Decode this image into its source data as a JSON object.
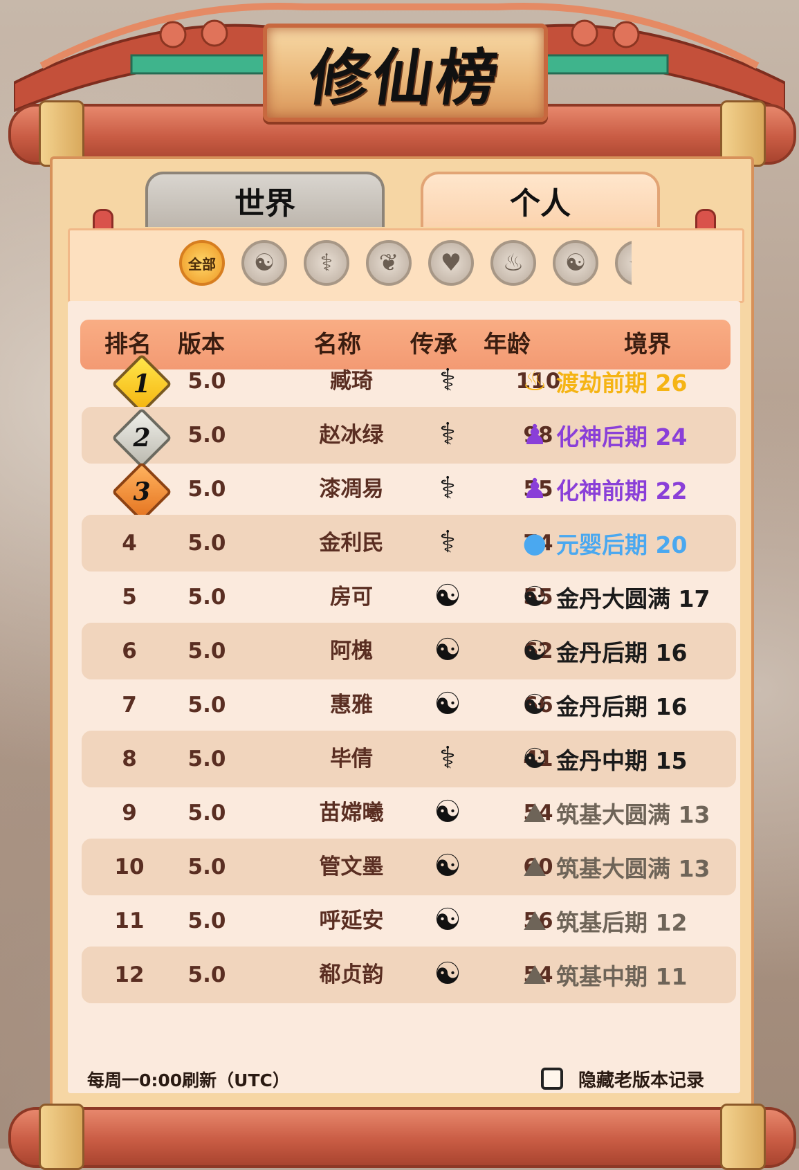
{
  "title": "修仙榜",
  "tabs": {
    "world": "世界",
    "personal": "个人"
  },
  "filter": {
    "all_label": "全部",
    "icons": [
      "yin-yang-icon",
      "sword-ring-icon",
      "open-book-icon",
      "heart-icon",
      "flame-icon",
      "swirl-icon",
      "partial-icon"
    ]
  },
  "table": {
    "headers": {
      "rank": "排名",
      "version": "版本",
      "name": "名称",
      "lineage": "传承",
      "age": "年龄",
      "realm": "境界"
    },
    "rows": [
      {
        "rank": "1",
        "version": "5.0",
        "name": "臧琦",
        "lineage": "sword-ring",
        "age": "110",
        "realm": "渡劫前期 26",
        "realm_color": "#f5b414",
        "realm_icon": "flame-figure"
      },
      {
        "rank": "2",
        "version": "5.0",
        "name": "赵冰绿",
        "lineage": "sword-ring",
        "age": "98",
        "realm": "化神后期 24",
        "realm_color": "#8a3fd8",
        "realm_icon": "meditating-figure"
      },
      {
        "rank": "3",
        "version": "5.0",
        "name": "漆凋易",
        "lineage": "sword-ring",
        "age": "55",
        "realm": "化神前期 22",
        "realm_color": "#8a3fd8",
        "realm_icon": "meditating-figure"
      },
      {
        "rank": "4",
        "version": "5.0",
        "name": "金利民",
        "lineage": "sword-ring",
        "age": "74",
        "realm": "元婴后期 20",
        "realm_color": "#4aa8f0",
        "realm_icon": "infant-figure"
      },
      {
        "rank": "5",
        "version": "5.0",
        "name": "房可",
        "lineage": "yin-yang",
        "age": "55",
        "realm": "金丹大圆满 17",
        "realm_color": "#1a1a1a",
        "realm_icon": "swirl-core"
      },
      {
        "rank": "6",
        "version": "5.0",
        "name": "阿槐",
        "lineage": "yin-yang",
        "age": "62",
        "realm": "金丹后期 16",
        "realm_color": "#1a1a1a",
        "realm_icon": "swirl-core"
      },
      {
        "rank": "7",
        "version": "5.0",
        "name": "惠雅",
        "lineage": "yin-yang",
        "age": "66",
        "realm": "金丹后期 16",
        "realm_color": "#1a1a1a",
        "realm_icon": "swirl-core"
      },
      {
        "rank": "8",
        "version": "5.0",
        "name": "毕倩",
        "lineage": "sword-ring",
        "age": "41",
        "realm": "金丹中期 15",
        "realm_color": "#1a1a1a",
        "realm_icon": "swirl-core"
      },
      {
        "rank": "9",
        "version": "5.0",
        "name": "苗嫦曦",
        "lineage": "yin-yang",
        "age": "54",
        "realm": "筑基大圆满 13",
        "realm_color": "#6e6458",
        "realm_icon": "praying-hands"
      },
      {
        "rank": "10",
        "version": "5.0",
        "name": "管文墨",
        "lineage": "yin-yang",
        "age": "60",
        "realm": "筑基大圆满 13",
        "realm_color": "#6e6458",
        "realm_icon": "praying-hands"
      },
      {
        "rank": "11",
        "version": "5.0",
        "name": "呼延安",
        "lineage": "yin-yang",
        "age": "56",
        "realm": "筑基后期 12",
        "realm_color": "#6e6458",
        "realm_icon": "praying-hands"
      },
      {
        "rank": "12",
        "version": "5.0",
        "name": "郗贞韵",
        "lineage": "yin-yang",
        "age": "54",
        "realm": "筑基中期 11",
        "realm_color": "#6e6458",
        "realm_icon": "praying-hands"
      }
    ]
  },
  "footer": {
    "refresh_note": "每周一0:00刷新（UTC）",
    "hide_old_label": "隐藏老版本记录",
    "hide_old_checked": false
  }
}
